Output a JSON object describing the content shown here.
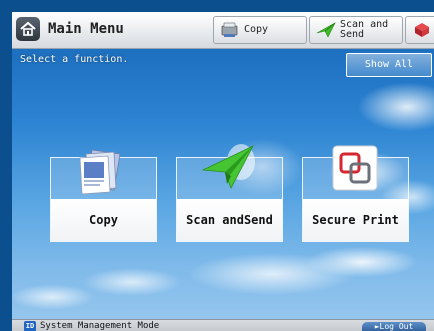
{
  "header": {
    "title": "Main Menu",
    "home_icon": "home-icon",
    "copy_label": "Copy",
    "scan_label_line1": "Scan and",
    "scan_label_line2": "Send"
  },
  "subheader": {
    "prompt": "Select a function.",
    "show_all_label": "Show All"
  },
  "functions": [
    {
      "label": "Copy",
      "icon": "copy-icon"
    },
    {
      "label_line1": "Scan and",
      "label_line2": "Send",
      "icon": "scan-send-icon"
    },
    {
      "label": "Secure Print",
      "icon": "secure-print-icon"
    }
  ],
  "footer": {
    "mode_label": "System Management Mode",
    "logout_label": "Log Out"
  },
  "colors": {
    "sky_top": "#1565b6",
    "sky_bottom": "#9ac8ee",
    "tile_border": "#ffffff",
    "accent_green": "#3dbb2a",
    "accent_red": "#d6262e"
  }
}
